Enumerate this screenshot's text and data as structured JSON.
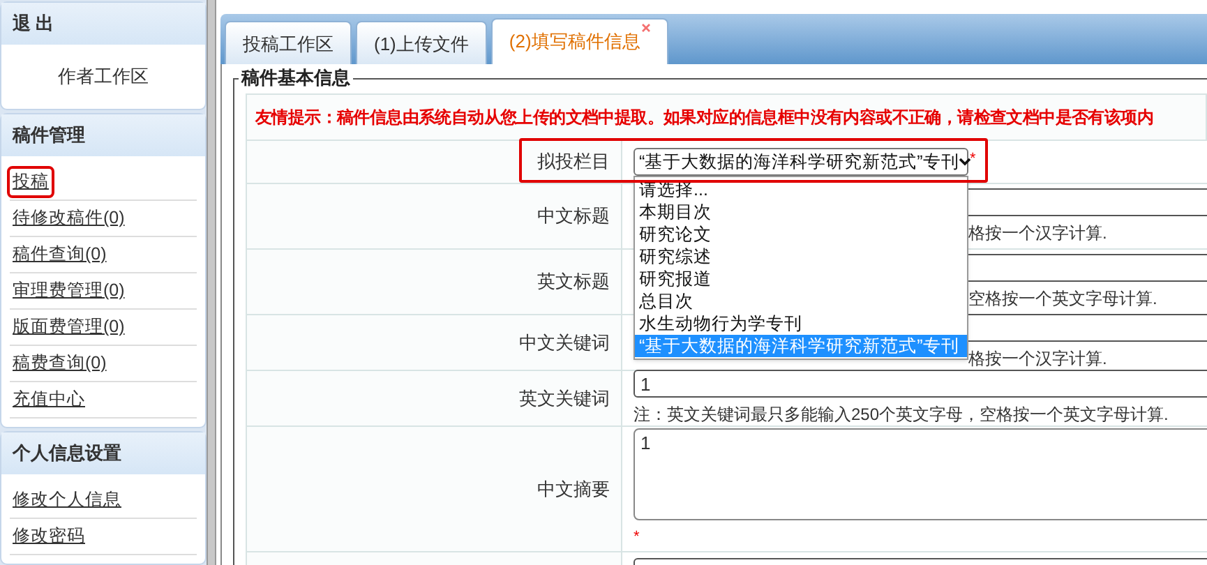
{
  "sidebar": {
    "sections": [
      {
        "title": "退 出",
        "items": [
          {
            "label": "作者工作区",
            "kind": "text",
            "highlighted": false
          }
        ]
      },
      {
        "title": "稿件管理",
        "items": [
          {
            "label": "投稿",
            "kind": "link",
            "highlighted": true
          },
          {
            "label": "待修改稿件(0)",
            "kind": "link",
            "highlighted": false
          },
          {
            "label": "稿件查询(0)",
            "kind": "link",
            "highlighted": false
          },
          {
            "label": "审理费管理(0)",
            "kind": "link",
            "highlighted": false
          },
          {
            "label": "版面费管理(0)",
            "kind": "link",
            "highlighted": false
          },
          {
            "label": "稿费查询(0)",
            "kind": "link",
            "highlighted": false
          },
          {
            "label": "充值中心",
            "kind": "link",
            "highlighted": false
          }
        ]
      },
      {
        "title": "个人信息设置",
        "items": [
          {
            "label": "修改个人信息",
            "kind": "link",
            "highlighted": false
          },
          {
            "label": "修改密码",
            "kind": "link",
            "highlighted": false
          }
        ]
      }
    ]
  },
  "tabs": [
    {
      "label": "投稿工作区",
      "selected": false,
      "closable": false
    },
    {
      "label": "(1)上传文件",
      "selected": false,
      "closable": false
    },
    {
      "label": "(2)填写稿件信息",
      "selected": true,
      "closable": true
    }
  ],
  "fieldset": {
    "legend": "稿件基本信息",
    "tip": "友情提示：稿件信息由系统自动从您上传的文档中提取。如果对应的信息框中没有内容或不正确，请检查文档中是否有该项内",
    "rows": [
      {
        "label": "拟投栏目",
        "kind": "select",
        "highlighted": true,
        "value": "“基于大数据的海洋科学研究新范式”专刊",
        "required_mark": "*",
        "options": [
          {
            "label": "请选择...",
            "selected": false
          },
          {
            "label": "本期目次",
            "selected": false
          },
          {
            "label": "研究论文",
            "selected": false
          },
          {
            "label": "研究综述",
            "selected": false
          },
          {
            "label": "研究报道",
            "selected": false
          },
          {
            "label": "总目次",
            "selected": false
          },
          {
            "label": "水生动物行为学专刊",
            "selected": false
          },
          {
            "label": "“基于大数据的海洋科学研究新范式”专刊",
            "selected": true
          }
        ]
      },
      {
        "label": "中文标题",
        "kind": "input",
        "highlighted": false,
        "note": "格按一个汉字计算."
      },
      {
        "label": "英文标题",
        "kind": "input",
        "highlighted": false,
        "note": "空格按一个英文字母计算."
      },
      {
        "label": "中文关键词",
        "kind": "input",
        "highlighted": false,
        "note": "格按一个汉字计算."
      },
      {
        "label": "英文关键词",
        "kind": "input",
        "highlighted": false,
        "value": "1",
        "note": "注：英文关键词最只多能输入250个英文字母，空格按一个英文字母计算."
      },
      {
        "label": "中文摘要",
        "kind": "textarea",
        "highlighted": false,
        "value": "1",
        "required_mark": "*"
      },
      {
        "kind": "input",
        "highlighted": false
      }
    ]
  }
}
